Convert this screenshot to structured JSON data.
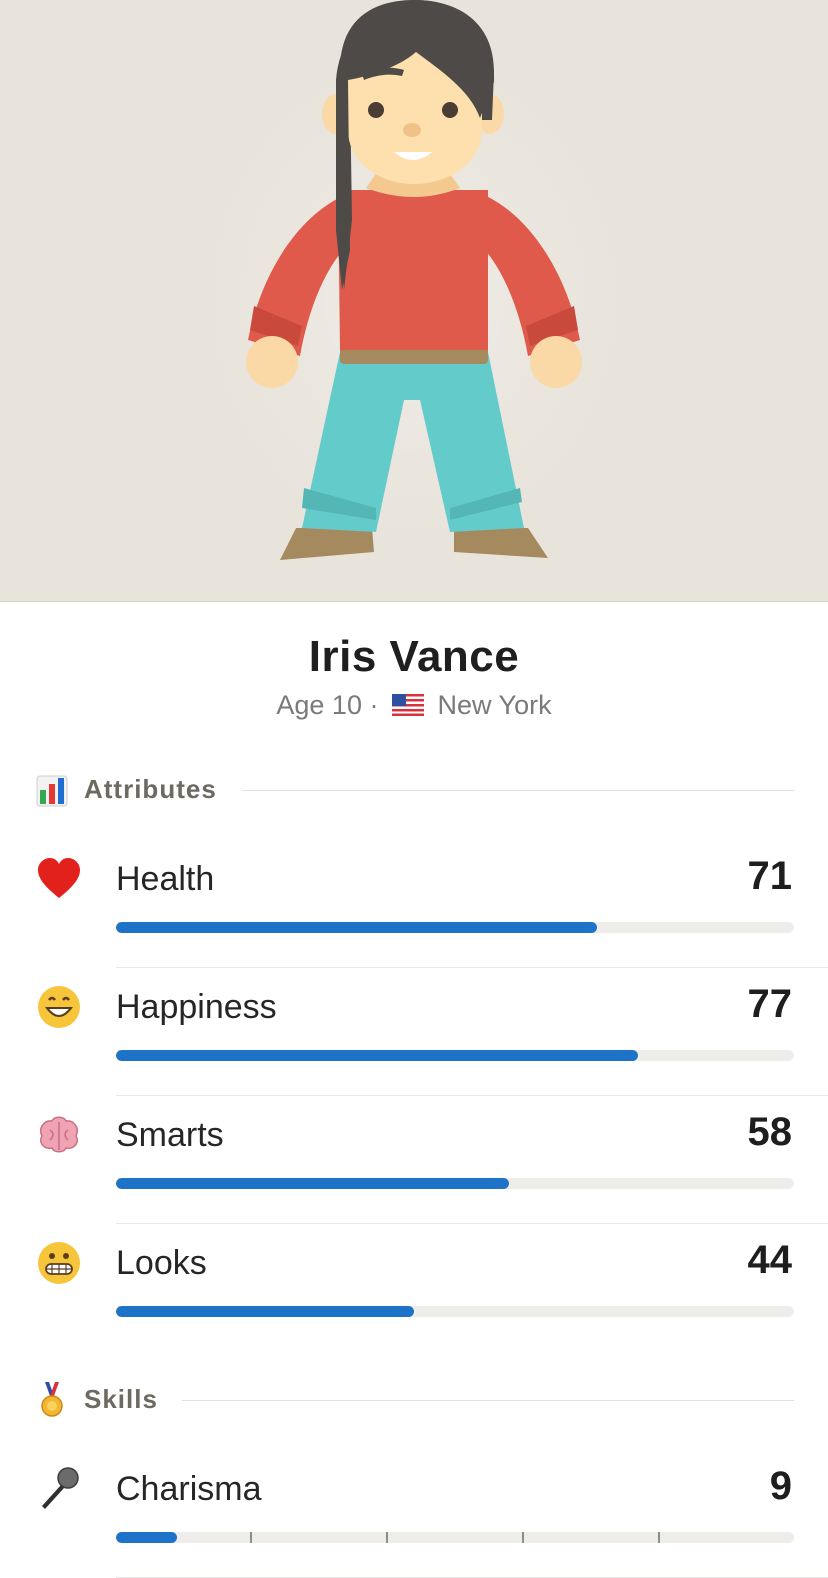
{
  "character": {
    "name": "Iris Vance",
    "age_text": "Age 10",
    "separator": "·",
    "location": "New York",
    "flag_icon": "us-flag-icon"
  },
  "attributes_section": {
    "title": "Attributes",
    "icon": "bar-chart-icon"
  },
  "attributes": [
    {
      "label": "Health",
      "value": "71",
      "level": 71,
      "icon": "red-heart-icon"
    },
    {
      "label": "Happiness",
      "value": "77",
      "level": 77,
      "icon": "grinning-face-icon"
    },
    {
      "label": "Smarts",
      "value": "58",
      "level": 58,
      "icon": "brain-icon"
    },
    {
      "label": "Looks",
      "value": "44",
      "level": 44,
      "icon": "grimacing-face-icon"
    }
  ],
  "skills_section": {
    "title": "Skills",
    "icon": "medal-icon"
  },
  "skills": [
    {
      "label": "Charisma",
      "value": "9",
      "level": 9,
      "icon": "microphone-icon"
    }
  ],
  "colors": {
    "bar_fill": "#1e73c9",
    "bar_track": "#efedea",
    "hero_bg": "#e8e4dc"
  }
}
